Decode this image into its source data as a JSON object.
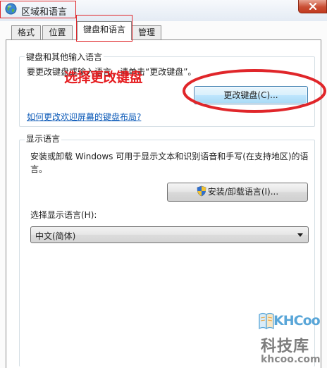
{
  "window": {
    "title": "区域和语言"
  },
  "tabs": [
    {
      "label": "格式",
      "active": false
    },
    {
      "label": "位置",
      "active": false
    },
    {
      "label": "键盘和语言",
      "active": true
    },
    {
      "label": "管理",
      "active": false
    }
  ],
  "keyboard_group": {
    "title": "键盘和其他输入语言",
    "description": "要更改键盘或输入语言，请单击“更改键盘”。",
    "change_keyboard_button": "更改键盘(C)...",
    "welcome_screen_link": "如何更改欢迎屏幕的键盘布局?"
  },
  "annotation": {
    "label": "选择更改键盘",
    "color": "#e51d20"
  },
  "display_language_group": {
    "title": "显示语言",
    "description_line1": "安装或卸载 Windows 可用于显示文本和识别语音和手写(在支持地区)的语",
    "description_line2": "言。",
    "install_button": "安装/卸载语言(I)...",
    "select_label": "选择显示语言(H):",
    "selected_language": "中文(简体)"
  },
  "watermark": {
    "brand": "KHCoo",
    "chinese": "科技库",
    "url": "khcoo.com"
  },
  "colors": {
    "link": "#0f5cb9",
    "annotation_red": "#e51d20",
    "close_red": "#c94e34"
  }
}
